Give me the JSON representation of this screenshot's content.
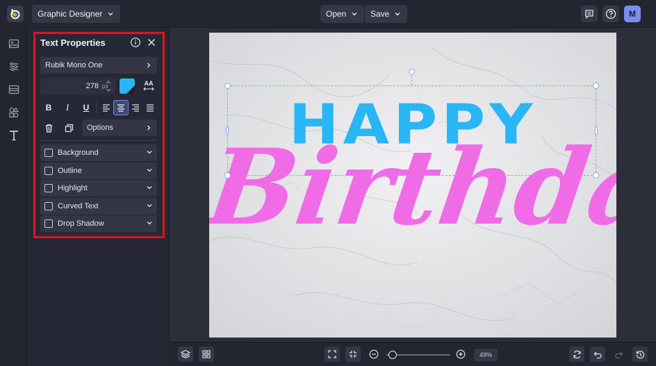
{
  "app": {
    "mode_label": "Graphic Designer",
    "open_label": "Open",
    "save_label": "Save",
    "avatar_initial": "M"
  },
  "text_properties": {
    "title": "Text Properties",
    "font_name": "Rubik Mono One",
    "font_size": "278",
    "font_unit": "px",
    "text_color": "#29b6f6",
    "case_label": "AA",
    "bold_label": "B",
    "italic_label": "I",
    "underline_label": "U",
    "options_label": "Options",
    "effects": [
      "Background",
      "Outline",
      "Highlight",
      "Curved Text",
      "Drop Shadow"
    ]
  },
  "canvas": {
    "headline": "HAPPY",
    "script_text": "Birthday",
    "headline_color": "#29b6f6",
    "script_color": "#f06be6"
  },
  "bottom": {
    "zoom": "49%"
  },
  "icons": {
    "rail": [
      "image-icon",
      "sliders-icon",
      "layout-icon",
      "shapes-icon",
      "text-icon"
    ]
  },
  "colors": {
    "accent": "#7b8cf0",
    "highlight_border": "#e0151c"
  }
}
